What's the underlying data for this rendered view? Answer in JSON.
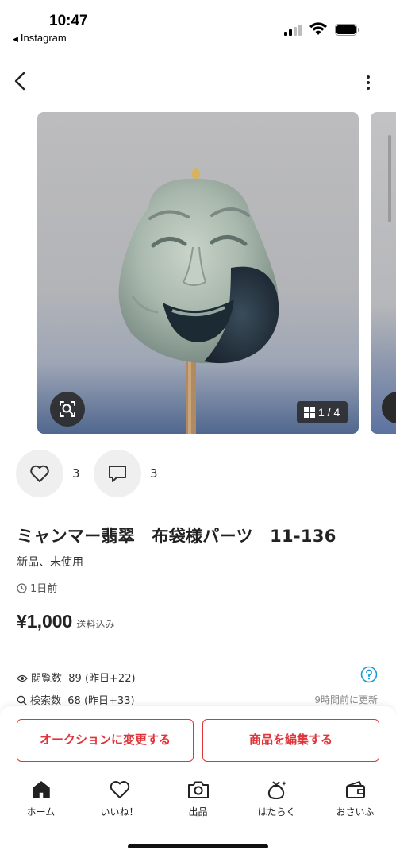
{
  "status_bar": {
    "time": "10:47",
    "back_app": "Instagram",
    "icons": [
      "signal-icon",
      "wifi-icon",
      "battery-icon"
    ]
  },
  "nav": {
    "icons": [
      "back-chevron-icon",
      "more-vertical-icon"
    ]
  },
  "gallery": {
    "page_indicator": "1 / 4",
    "current_page": 1,
    "total_pages": 4,
    "icons": [
      "lens-search-icon",
      "grid-icon"
    ]
  },
  "actions": {
    "like_count": "3",
    "comment_count": "3",
    "icons": [
      "heart-icon",
      "comment-icon"
    ]
  },
  "product": {
    "title": "ミャンマー翡翠　布袋様パーツ　11-136",
    "condition": "新品、未使用",
    "posted": "1日前",
    "price": "¥1,000",
    "shipping": "送料込み"
  },
  "stats": {
    "views_label": "閲覧数",
    "views_value": "89 (昨日+22)",
    "searches_label": "検索数",
    "searches_value": "68 (昨日+33)",
    "updated": "9時間前に更新",
    "icons": [
      "eye-icon",
      "search-icon",
      "help-icon"
    ]
  },
  "buttons": {
    "auction": "オークションに変更する",
    "edit": "商品を編集する"
  },
  "tabbar": {
    "home": "ホーム",
    "likes": "いいね！",
    "sell": "出品",
    "work": "はたらく",
    "wallet": "おさいふ",
    "icons": [
      "home-icon",
      "heart-icon",
      "camera-icon",
      "money-bag-icon",
      "wallet-icon"
    ]
  },
  "colors": {
    "accent_red": "#e0343a",
    "help_blue": "#1a9ad6",
    "text": "#222222"
  }
}
